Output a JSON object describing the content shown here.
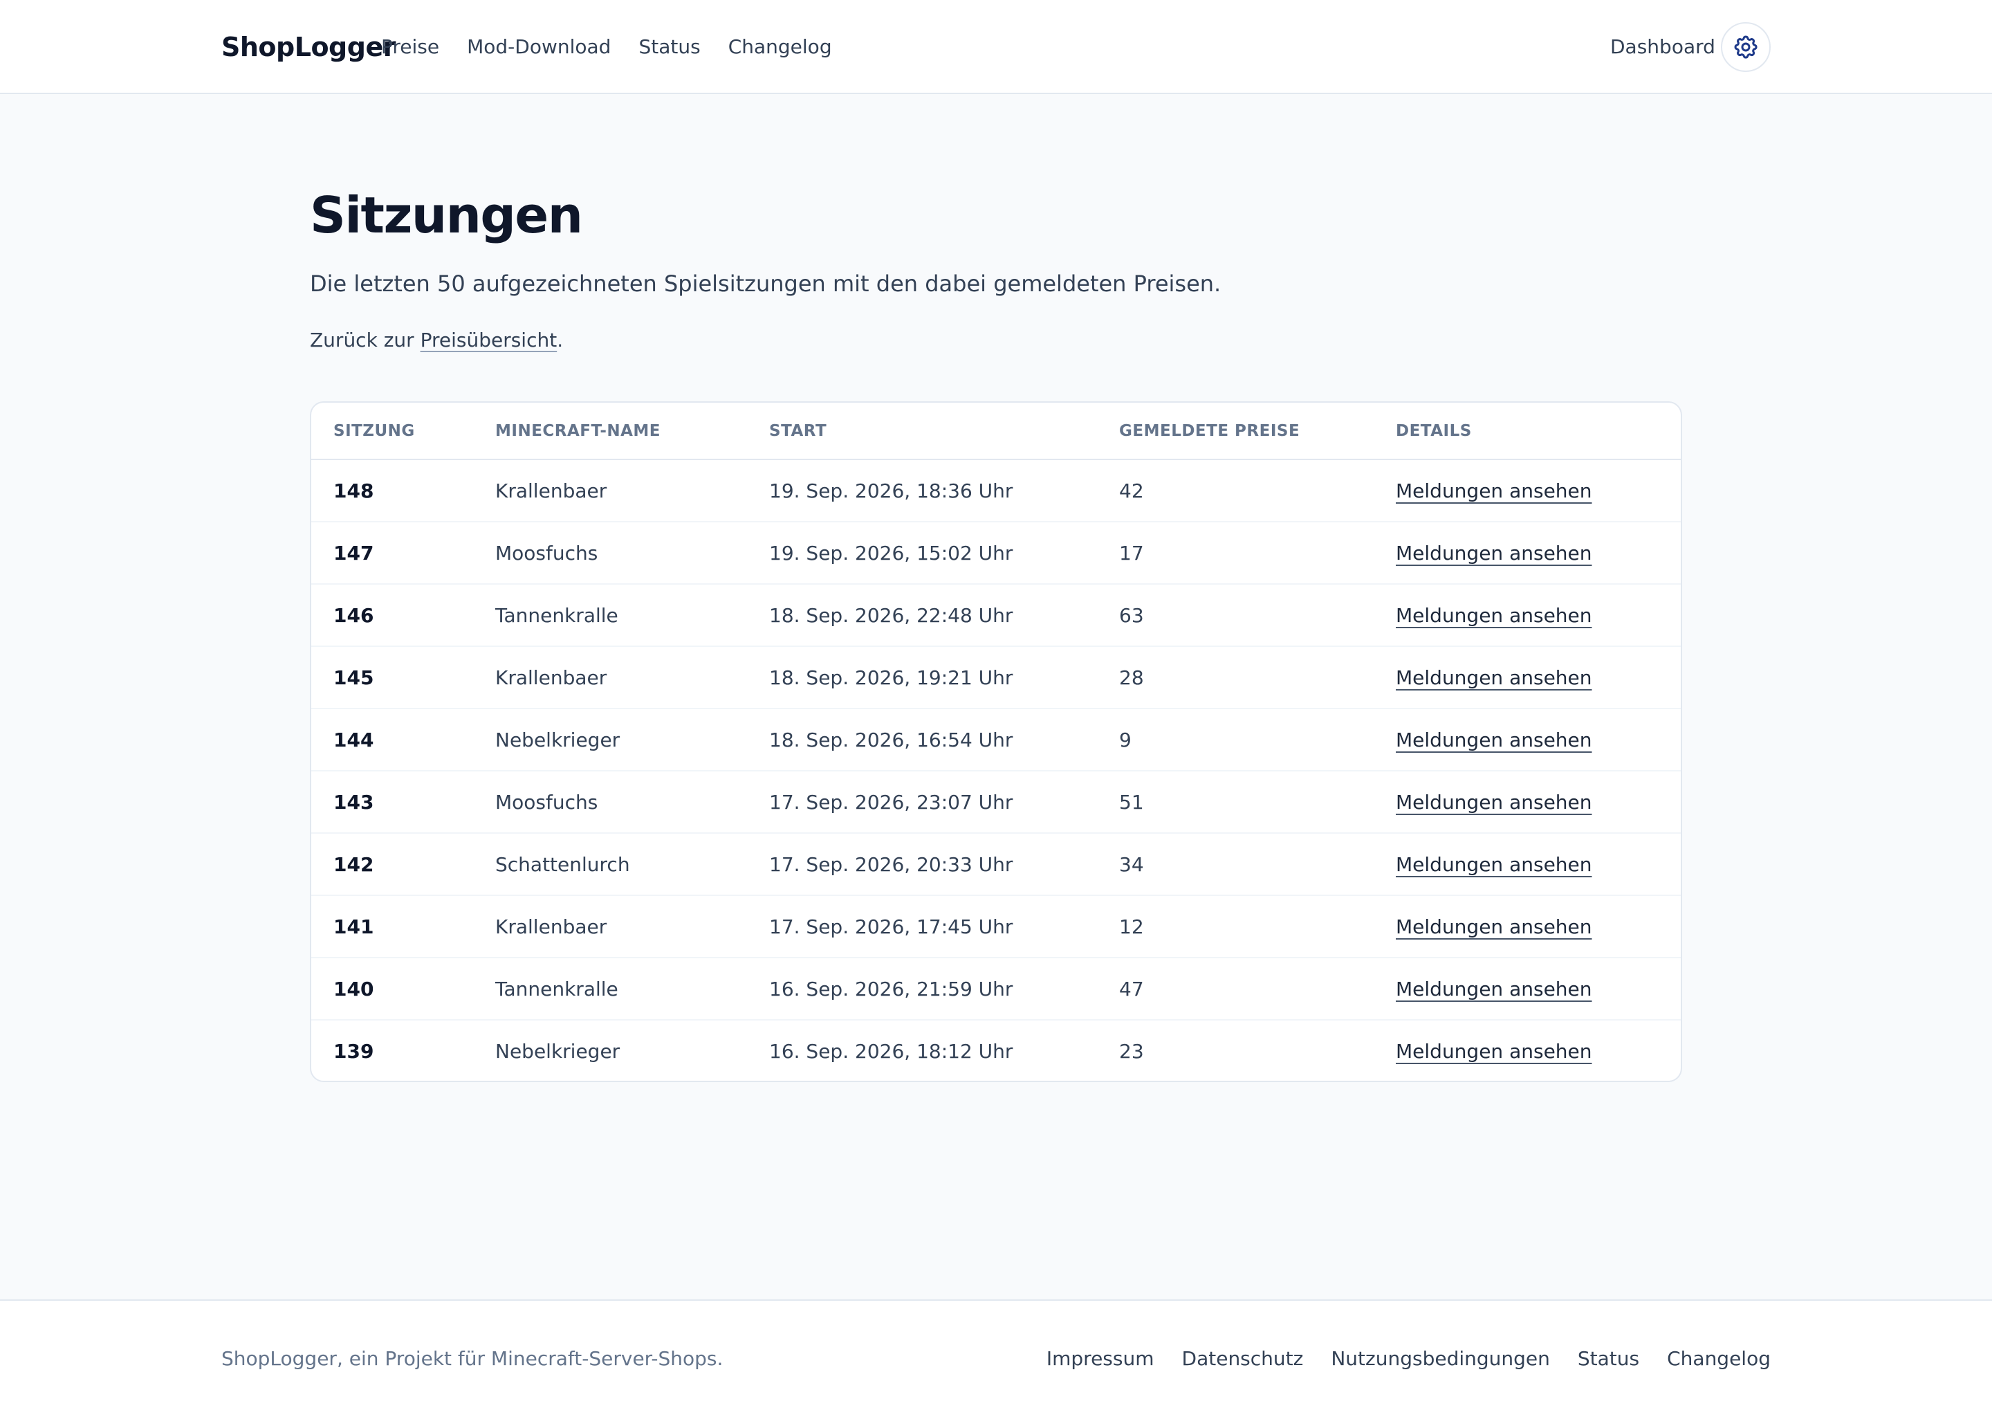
{
  "header": {
    "brand": "ShopLogger",
    "nav": [
      "Preise",
      "Mod-Download",
      "Status",
      "Changelog"
    ],
    "dashboard_label": "Dashboard",
    "settings_icon": "gear-icon"
  },
  "main": {
    "title": "Sitzungen",
    "subtitle": "Die letzten 50 aufgezeichneten Spielsitzungen mit den dabei gemeldeten Preisen.",
    "back_prefix": "Zurück zur ",
    "back_link": "Preisübersicht",
    "back_suffix": "."
  },
  "table": {
    "headers": [
      "Sitzung",
      "Minecraft-Name",
      "Start",
      "Gemeldete Preise",
      "Details"
    ],
    "rows": [
      {
        "id": "148",
        "name": "Krallenbaer",
        "start": "19. Sep. 2026, 18:36 Uhr",
        "count": "42",
        "link": "Meldungen ansehen"
      },
      {
        "id": "147",
        "name": "Moosfuchs",
        "start": "19. Sep. 2026, 15:02 Uhr",
        "count": "17",
        "link": "Meldungen ansehen"
      },
      {
        "id": "146",
        "name": "Tannenkralle",
        "start": "18. Sep. 2026, 22:48 Uhr",
        "count": "63",
        "link": "Meldungen ansehen"
      },
      {
        "id": "145",
        "name": "Krallenbaer",
        "start": "18. Sep. 2026, 19:21 Uhr",
        "count": "28",
        "link": "Meldungen ansehen"
      },
      {
        "id": "144",
        "name": "Nebelkrieger",
        "start": "18. Sep. 2026, 16:54 Uhr",
        "count": "9",
        "link": "Meldungen ansehen"
      },
      {
        "id": "143",
        "name": "Moosfuchs",
        "start": "17. Sep. 2026, 23:07 Uhr",
        "count": "51",
        "link": "Meldungen ansehen"
      },
      {
        "id": "142",
        "name": "Schattenlurch",
        "start": "17. Sep. 2026, 20:33 Uhr",
        "count": "34",
        "link": "Meldungen ansehen"
      },
      {
        "id": "141",
        "name": "Krallenbaer",
        "start": "17. Sep. 2026, 17:45 Uhr",
        "count": "12",
        "link": "Meldungen ansehen"
      },
      {
        "id": "140",
        "name": "Tannenkralle",
        "start": "16. Sep. 2026, 21:59 Uhr",
        "count": "47",
        "link": "Meldungen ansehen"
      },
      {
        "id": "139",
        "name": "Nebelkrieger",
        "start": "16. Sep. 2026, 18:12 Uhr",
        "count": "23",
        "link": "Meldungen ansehen"
      }
    ]
  },
  "footer": {
    "text": "ShopLogger, ein Projekt für Minecraft-Server-Shops.",
    "links": [
      "Impressum",
      "Datenschutz",
      "Nutzungsbedingungen",
      "Status",
      "Changelog"
    ]
  },
  "colors": {
    "background": "#f8fafc",
    "surface": "#ffffff",
    "text": "#0f172a",
    "muted": "#64748b",
    "accent": "#1e3a8a"
  }
}
